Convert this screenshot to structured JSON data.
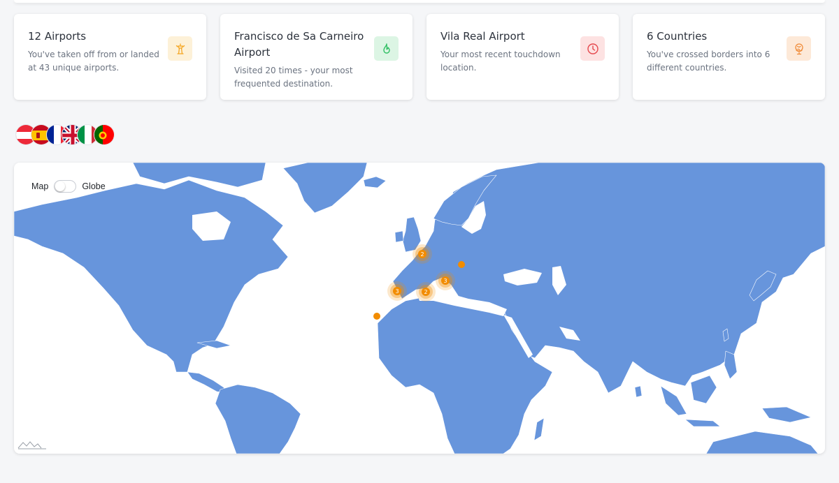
{
  "stats": [
    {
      "title": "12 Airports",
      "description": "You've taken off from or landed at 43 unique airports.",
      "icon": "airport-tower-icon",
      "icon_color": "#f5a623",
      "icon_bg": "#fdf1d8"
    },
    {
      "title": "Francisco de Sa Carneiro Airport",
      "description": "Visited 20 times - your most frequented destination.",
      "icon": "flame-icon",
      "icon_color": "#2fbf63",
      "icon_bg": "#dcf5e4"
    },
    {
      "title": "Vila Real Airport",
      "description": "Your most recent touchdown location.",
      "icon": "clock-icon",
      "icon_color": "#e5484d",
      "icon_bg": "#fde2e2"
    },
    {
      "title": "6 Countries",
      "description": "You've crossed borders into 6 different countries.",
      "icon": "globe-icon",
      "icon_color": "#f08c3a",
      "icon_bg": "#fde9d8"
    }
  ],
  "flags": [
    "Austria",
    "Spain",
    "France",
    "United Kingdom",
    "Italy",
    "Portugal"
  ],
  "map": {
    "toggle_left": "Map",
    "toggle_right": "Globe",
    "land_color": "#6795dc",
    "marker_color": "#f28c00",
    "clusters": [
      {
        "label": "2",
        "region": "France/Belgium"
      },
      {
        "label": "3",
        "region": "Northern Italy/Monaco"
      },
      {
        "label": "2",
        "region": "Catalonia"
      },
      {
        "label": "3",
        "region": "Portugal"
      }
    ],
    "points": [
      "Austria",
      "Madeira"
    ]
  }
}
